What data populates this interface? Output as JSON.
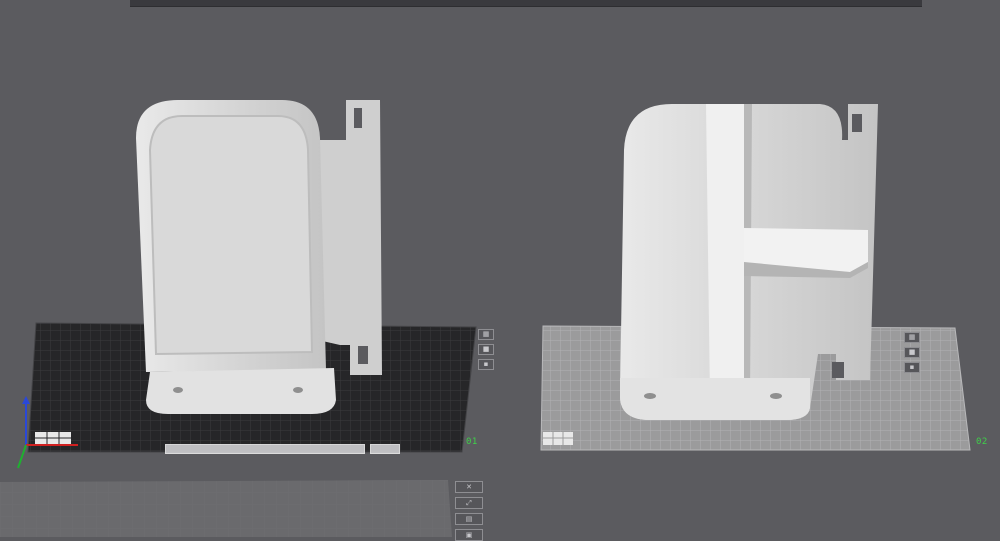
{
  "plates": [
    {
      "id": "plate-1",
      "label": "01",
      "theme": "dark"
    },
    {
      "id": "plate-2",
      "label": "02",
      "theme": "light"
    }
  ],
  "plate_tools": [
    {
      "name": "arrange-icon"
    },
    {
      "name": "lock-icon"
    },
    {
      "name": "settings-icon"
    }
  ],
  "bottom_plate_tools": [
    {
      "name": "close-icon"
    },
    {
      "name": "move-icon"
    },
    {
      "name": "layout-icon"
    },
    {
      "name": "lock-icon"
    }
  ],
  "colors": {
    "background": "#5b5b5f",
    "plate_dark": "#262628",
    "plate_light": "#9b9b9c",
    "model": "#d8d8d8",
    "plate_label": "#3fd14a",
    "axis_z": "#2a48d8",
    "axis_x": "#d02020"
  }
}
